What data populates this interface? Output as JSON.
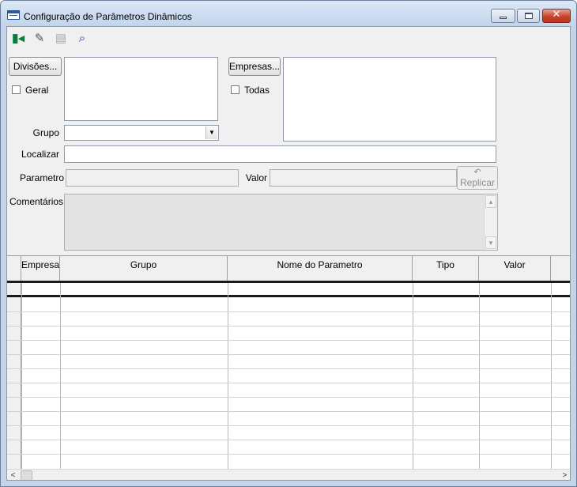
{
  "window": {
    "title": "Configuração de Parâmetros Dinâmicos",
    "controls": {
      "minimize": "minimize",
      "maximize": "maximize",
      "close": "✕"
    }
  },
  "toolbar": {
    "items": [
      {
        "name": "exit",
        "icon": "exit-door-icon",
        "glyph": "▮◂"
      },
      {
        "name": "edit",
        "icon": "pencil-icon",
        "glyph": "✎"
      },
      {
        "name": "print",
        "icon": "printer-icon",
        "glyph": "▤"
      },
      {
        "name": "find",
        "icon": "binoculars-icon",
        "glyph": "⌕"
      }
    ]
  },
  "form": {
    "divisoes_button": "Divisões...",
    "geral_checkbox": "Geral",
    "empresas_button": "Empresas...",
    "todas_checkbox": "Todas",
    "grupo_label": "Grupo",
    "grupo_value": "",
    "localizar_label": "Localizar",
    "localizar_value": "",
    "parametro_label": "Parametro",
    "parametro_value": "",
    "valor_label": "Valor",
    "valor_value": "",
    "replicar_button": "Replicar",
    "comentarios_label": "Comentários",
    "comentarios_value": ""
  },
  "grid": {
    "columns": [
      "Empresa",
      "Grupo",
      "Nome do Parametro",
      "Tipo",
      "Valor"
    ],
    "rows": []
  }
}
